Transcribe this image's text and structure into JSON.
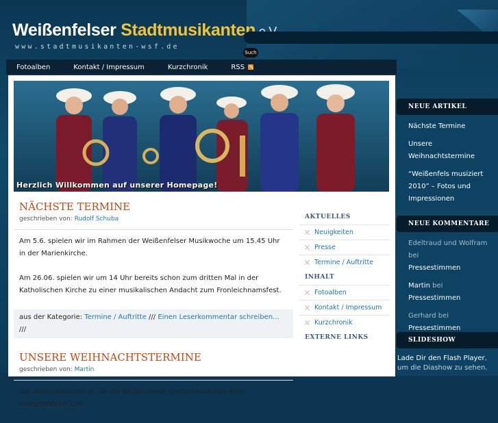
{
  "header": {
    "logo_prefix": "Weißenfelser ",
    "logo_highlight": "Stadtmusikanten",
    "logo_suffix": " e.V.",
    "url_text": "www.stadtmusikanten-wsf.de",
    "search_button": "Such",
    "search_value": ""
  },
  "nav": {
    "items": [
      "Fotoalben",
      "Kontakt / Impressum",
      "Kurzchronik",
      "RSS"
    ]
  },
  "banner": {
    "caption": "Herzlich Willkommen auf unserer Homepage!"
  },
  "posts": [
    {
      "title": "NÄCHSTE TERMINE",
      "byline_label": "geschrieben von:",
      "author": "Rudolf Schuba",
      "paragraphs": [
        "Am 5.6. spielen wir im Rahmen der Weißenfelser Musikwoche um 15.45 Uhr in der Marienkirche.",
        "Am 26.06. spielen wir um 14 Uhr bereits schon zum dritten Mal in der Katholischen Kirche zu einer musikalischen Andacht zum Fronleichnamsfest."
      ],
      "category_label": "aus der Kategorie:",
      "category": "Termine / Auftritte",
      "separator": "///",
      "comment_link": "Einen Leserkommentar schreiben...",
      "trail": "///"
    },
    {
      "title": "UNSERE WEIHNACHTSTERMINE",
      "byline_label": "geschrieben von:",
      "author": "Martin",
      "paragraphs": [
        "Die Weihnachtszeit ist für die Weißenfelser Stadtmusikanten eine ereignisreiche Zeit"
      ]
    }
  ],
  "inner_sidebar": {
    "aktuelles_title": "AKTUELLES",
    "aktuelles": [
      "Neuigkeiten",
      "Presse",
      "Termine / Auftritte"
    ],
    "inhalt_title": "INHALT",
    "inhalt": [
      "Fotoalben",
      "Kontakt / Impressum",
      "Kurzchronik"
    ],
    "externe_title": "EXTERNE LINKS"
  },
  "outer_sidebar": {
    "neue_artikel_title": "NEUE ARTIKEL",
    "neue_artikel": [
      "Nächste Termine",
      "Unsere Weihnachtstermine",
      "“Weißenfels musiziert 2010” – Fotos und Impressionen"
    ],
    "kommentare_title": "NEUE KOMMENTARE",
    "kommentare": [
      {
        "author": "Edeltraud und Wolfram",
        "on": "bei",
        "post": "Pressestimmen"
      },
      {
        "author": "Martin",
        "on": "bei",
        "post": "Pressestimmen"
      },
      {
        "author": "Gerhard",
        "on": "bei",
        "post": "Pressestimmen"
      }
    ],
    "slideshow_title": "SLIDESHOW",
    "flash_link": "Lade Dir den Flash Player",
    "flash_text": ", um die Diashow zu sehen."
  },
  "colors": {
    "accent_orange": "#c44812",
    "link_blue": "#1f78a7",
    "logo_yellow": "#f0c43a",
    "nav_bg": "#0a2233"
  }
}
